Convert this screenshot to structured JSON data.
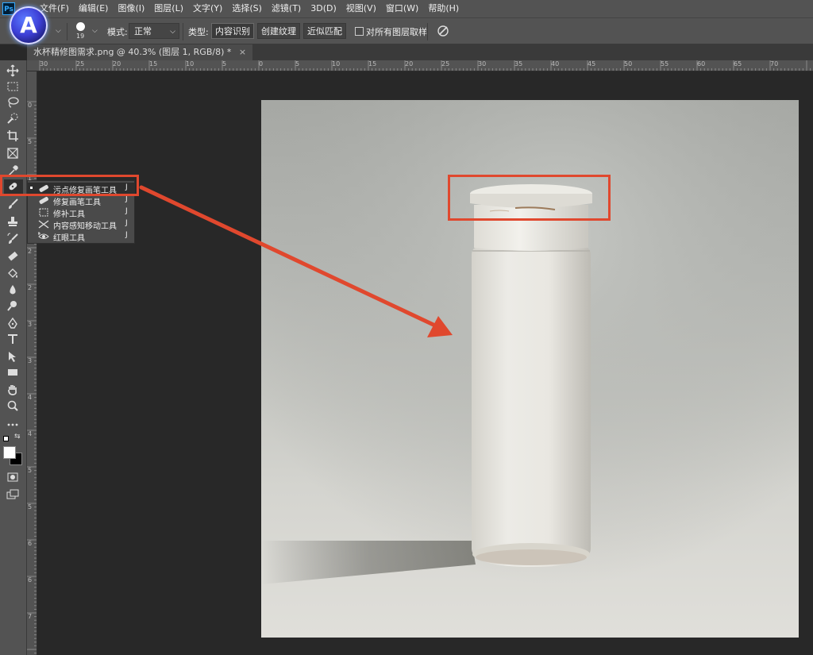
{
  "menubar": {
    "logo": "Ps",
    "items": [
      "文件(F)",
      "编辑(E)",
      "图像(I)",
      "图层(L)",
      "文字(Y)",
      "选择(S)",
      "滤镜(T)",
      "3D(D)",
      "视图(V)",
      "窗口(W)",
      "帮助(H)"
    ]
  },
  "avatar": {
    "letter": "A"
  },
  "options": {
    "brush_size": "19",
    "mode_label": "模式:",
    "mode_value": "正常",
    "type_label": "类型:",
    "type_buttons": [
      "内容识别",
      "创建纹理",
      "近似匹配"
    ],
    "sample_all_layers": "对所有图层取样"
  },
  "document": {
    "tab_title": "水杯精修图需求.png @ 40.3% (图层 1, RGB/8) *"
  },
  "ruler": {
    "top_labels": [
      "30",
      "25",
      "20",
      "15",
      "10",
      "5",
      "0",
      "5",
      "10",
      "15",
      "20",
      "25",
      "30",
      "35",
      "40",
      "45",
      "50",
      "55",
      "60",
      "65",
      "70"
    ],
    "left_labels": [
      "0",
      "5",
      "1",
      "1",
      "2",
      "2",
      "3",
      "3",
      "4",
      "4",
      "5",
      "5",
      "6",
      "6",
      "7"
    ]
  },
  "flyout": {
    "items": [
      {
        "label": "污点修复画笔工具",
        "shortcut": "J",
        "icon": "spot-healing-brush-icon"
      },
      {
        "label": "修复画笔工具",
        "shortcut": "J",
        "icon": "healing-brush-icon"
      },
      {
        "label": "修补工具",
        "shortcut": "J",
        "icon": "patch-icon"
      },
      {
        "label": "内容感知移动工具",
        "shortcut": "J",
        "icon": "content-aware-move-icon"
      },
      {
        "label": "红眼工具",
        "shortcut": "J",
        "icon": "red-eye-icon"
      }
    ]
  },
  "colors": {
    "annotation": "#e0482e",
    "panel": "#535353",
    "canvas_bg": "#282828"
  }
}
